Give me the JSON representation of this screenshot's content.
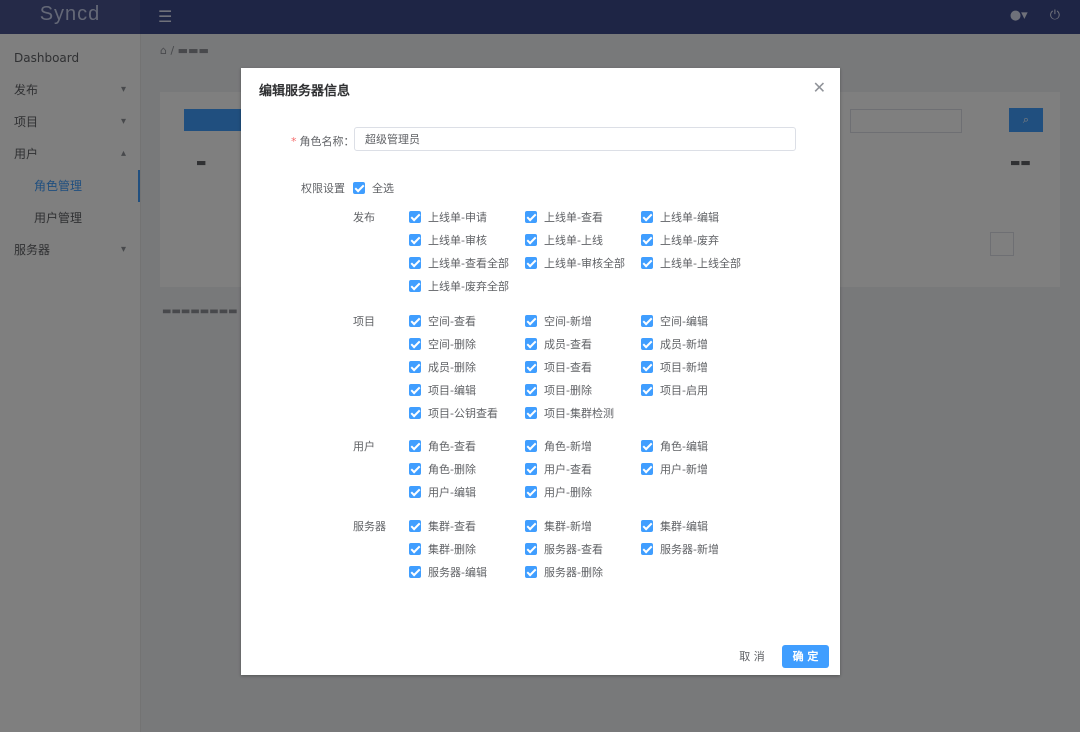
{
  "app": {
    "logo": "Syncd"
  },
  "header": {
    "menu_icon": "menu-icon",
    "bell_icon": "bell-icon",
    "power_icon": "power-icon"
  },
  "sidebar": {
    "items": [
      {
        "label": "Dashboard"
      },
      {
        "label": "发布"
      },
      {
        "label": "项目"
      },
      {
        "label": "用户"
      },
      {
        "label": "角色管理"
      },
      {
        "label": "用户管理"
      },
      {
        "label": "服务器"
      }
    ]
  },
  "dialog": {
    "title": "编辑服务器信息",
    "role_name_label": "角色名称：",
    "role_name_value": "超级管理员",
    "permission_label": "权限设置",
    "select_all_label": "全选",
    "cancel_label": "取 消",
    "ok_label": "确 定",
    "groups": [
      {
        "name": "发布",
        "perms": [
          "上线单-申请",
          "上线单-查看",
          "上线单-编辑",
          "上线单-审核",
          "上线单-上线",
          "上线单-废弃",
          "上线单-查看全部",
          "上线单-审核全部",
          "上线单-上线全部",
          "上线单-废弃全部"
        ]
      },
      {
        "name": "项目",
        "perms": [
          "空间-查看",
          "空间-新增",
          "空间-编辑",
          "空间-删除",
          "成员-查看",
          "成员-新增",
          "成员-删除",
          "项目-查看",
          "项目-新增",
          "项目-编辑",
          "项目-删除",
          "项目-启用",
          "项目-公钥查看",
          "项目-集群检测"
        ]
      },
      {
        "name": "用户",
        "perms": [
          "角色-查看",
          "角色-新增",
          "角色-编辑",
          "角色-删除",
          "用户-查看",
          "用户-新增",
          "用户-编辑",
          "用户-删除"
        ]
      },
      {
        "name": "服务器",
        "perms": [
          "集群-查看",
          "集群-新增",
          "集群-编辑",
          "集群-删除",
          "服务器-查看",
          "服务器-新增",
          "服务器-编辑",
          "服务器-删除"
        ]
      }
    ]
  },
  "colors": {
    "primary": "#409eff",
    "topbar": "#3c4a8a"
  }
}
